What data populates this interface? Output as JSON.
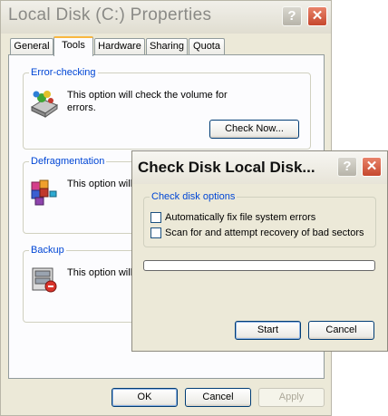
{
  "main_window": {
    "title": "Local Disk (C:) Properties",
    "help_glyph": "?",
    "close_glyph": "✕",
    "tabs": [
      {
        "label": "General"
      },
      {
        "label": "Tools"
      },
      {
        "label": "Hardware"
      },
      {
        "label": "Sharing"
      },
      {
        "label": "Quota"
      }
    ],
    "active_tab": "Tools",
    "error_checking": {
      "legend": "Error-checking",
      "description_line1": "This option will check the volume for",
      "description_line2": "errors.",
      "button": "Check Now...",
      "icon": "disk-check-icon"
    },
    "defragmentation": {
      "legend": "Defragmentation",
      "description_partial": "This option will",
      "icon": "defragment-icon"
    },
    "backup": {
      "legend": "Backup",
      "description_partial": "This option will",
      "icon": "backup-icon"
    },
    "buttons": {
      "ok": "OK",
      "cancel": "Cancel",
      "apply": "Apply"
    }
  },
  "check_disk_dialog": {
    "title": "Check Disk Local Disk...",
    "help_glyph": "?",
    "close_glyph": "✕",
    "options_legend": "Check disk options",
    "options": [
      {
        "label": "Automatically fix file system errors",
        "checked": false
      },
      {
        "label": "Scan for and attempt recovery of bad sectors",
        "checked": false
      }
    ],
    "progress": 0,
    "buttons": {
      "start": "Start",
      "cancel": "Cancel"
    }
  },
  "colors": {
    "window_face": "#ece9d8",
    "legend_blue": "#0046d5",
    "close_red": "#c6472d",
    "active_tab_accent": "#f9b73f"
  }
}
